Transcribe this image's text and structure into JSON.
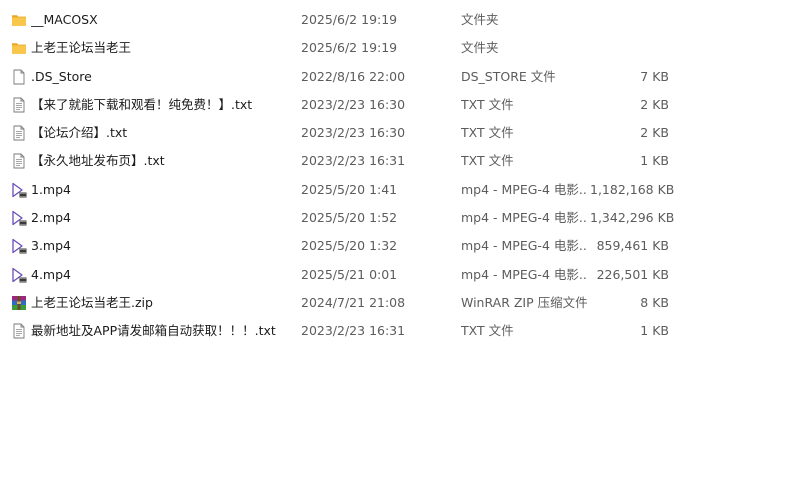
{
  "files": [
    {
      "icon": "folder-icon",
      "name": "__MACOSX",
      "date": "2025/6/2 19:19",
      "type": "文件夹",
      "size": ""
    },
    {
      "icon": "folder-icon",
      "name": "上老王论坛当老王",
      "date": "2025/6/2 19:19",
      "type": "文件夹",
      "size": ""
    },
    {
      "icon": "blank-file-icon",
      "name": ".DS_Store",
      "date": "2022/8/16 22:00",
      "type": "DS_STORE 文件",
      "size": "7 KB"
    },
    {
      "icon": "text-file-icon",
      "name": "【来了就能下载和观看！纯免费！】.txt",
      "date": "2023/2/23 16:30",
      "type": "TXT 文件",
      "size": "2 KB"
    },
    {
      "icon": "text-file-icon",
      "name": "【论坛介绍】.txt",
      "date": "2023/2/23 16:30",
      "type": "TXT 文件",
      "size": "2 KB"
    },
    {
      "icon": "text-file-icon",
      "name": "【永久地址发布页】.txt",
      "date": "2023/2/23 16:31",
      "type": "TXT 文件",
      "size": "1 KB"
    },
    {
      "icon": "video-file-icon",
      "name": "1.mp4",
      "date": "2025/5/20 1:41",
      "type": "mp4 - MPEG-4 电影...",
      "size": "1,182,168 KB"
    },
    {
      "icon": "video-file-icon",
      "name": "2.mp4",
      "date": "2025/5/20 1:52",
      "type": "mp4 - MPEG-4 电影...",
      "size": "1,342,296 KB"
    },
    {
      "icon": "video-file-icon",
      "name": "3.mp4",
      "date": "2025/5/20 1:32",
      "type": "mp4 - MPEG-4 电影...",
      "size": "859,461 KB"
    },
    {
      "icon": "video-file-icon",
      "name": "4.mp4",
      "date": "2025/5/21 0:01",
      "type": "mp4 - MPEG-4 电影...",
      "size": "226,501 KB"
    },
    {
      "icon": "winrar-archive-icon",
      "name": "上老王论坛当老王.zip",
      "date": "2024/7/21 21:08",
      "type": "WinRAR ZIP 压缩文件",
      "size": "8 KB"
    },
    {
      "icon": "text-file-icon",
      "name": "最新地址及APP请发邮箱自动获取！！！.txt",
      "date": "2023/2/23 16:31",
      "type": "TXT 文件",
      "size": "1 KB"
    }
  ],
  "colors": {
    "folder": "#f8c64a",
    "text": "#1b1b1b",
    "secondary": "#5c5c5c",
    "video": "#6b4fb4"
  }
}
